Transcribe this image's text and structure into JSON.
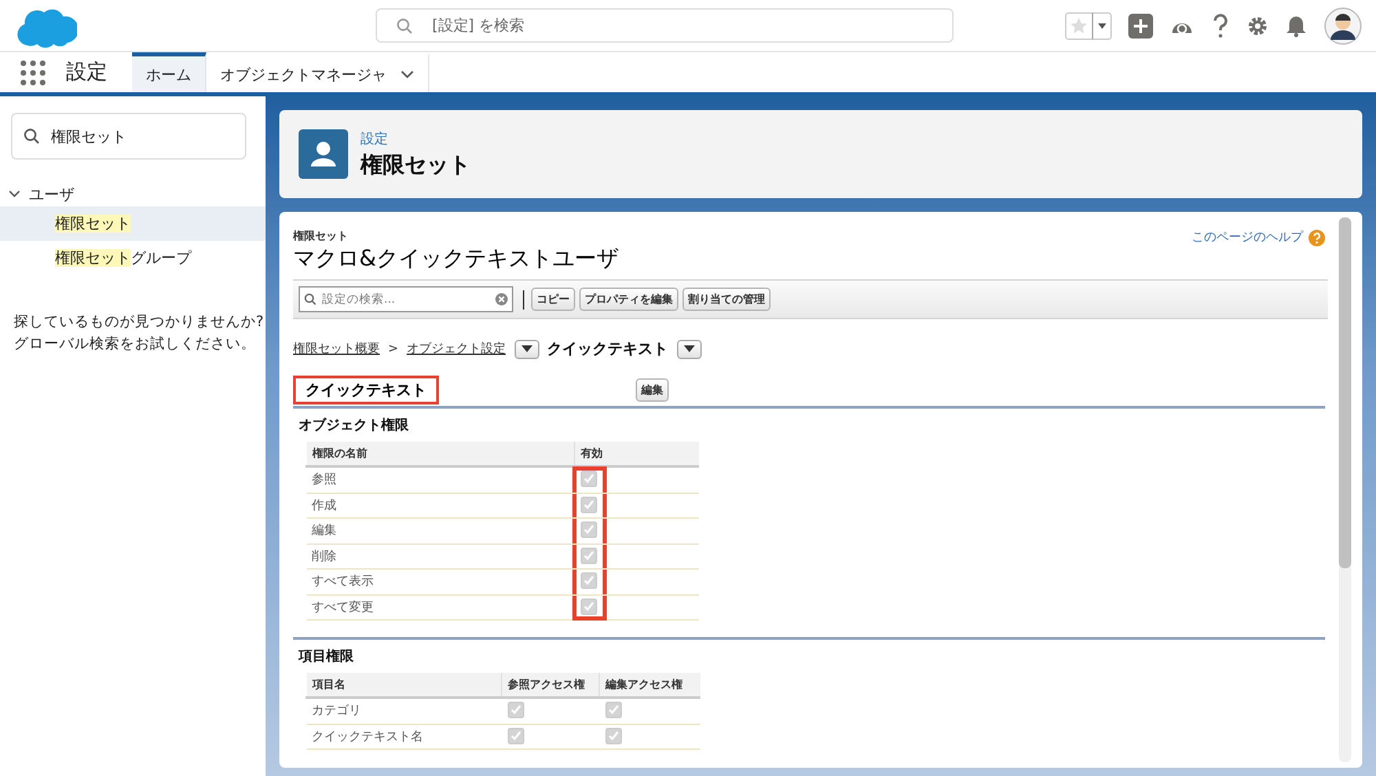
{
  "global_search": {
    "placeholder": "[設定] を検索"
  },
  "nav": {
    "app_name": "設定",
    "tabs": [
      {
        "label": "ホーム",
        "selected": true,
        "has_menu": false
      },
      {
        "label": "オブジェクトマネージャ",
        "selected": false,
        "has_menu": true
      }
    ]
  },
  "sidebar": {
    "search_value": "権限セット",
    "tree": [
      {
        "label": "ユーザ",
        "expanded": true,
        "children": [
          {
            "highlight": "権限セット",
            "selected": true
          },
          {
            "highlight": "権限セット",
            "rest": "グループ",
            "selected": false
          }
        ]
      }
    ],
    "hint_lines": [
      "探しているものが見つかりませんか?",
      "グローバル検索をお試しください。"
    ]
  },
  "page_header": {
    "breadcrumb": "設定",
    "title": "権限セット"
  },
  "detail": {
    "type_label": "権限セット",
    "title": "マクロ&クイックテキストユーザ",
    "help_link": "このページのヘルプ",
    "search": {
      "placeholder": "設定の検索..."
    },
    "toolbar_buttons": [
      "コピー",
      "プロパティを編集",
      "割り当ての管理"
    ],
    "breadcrumbs": [
      {
        "label": "権限セット概要",
        "kind": "link"
      },
      {
        "label": ">",
        "kind": "separator"
      },
      {
        "label": "オブジェクト設定",
        "kind": "menu-link"
      },
      {
        "label": "クイックテキスト",
        "kind": "menu-current"
      }
    ],
    "section": {
      "title": "クイックテキスト",
      "annotated": true,
      "edit_button": "編集"
    },
    "object_permissions": {
      "title": "オブジェクト権限",
      "enabled_column_annotated": true,
      "columns": [
        "権限の名前",
        "有効"
      ],
      "rows": [
        {
          "name": "参照",
          "checked": true
        },
        {
          "name": "作成",
          "checked": true
        },
        {
          "name": "編集",
          "checked": true
        },
        {
          "name": "削除",
          "checked": true
        },
        {
          "name": "すべて表示",
          "checked": true
        },
        {
          "name": "すべて変更",
          "checked": true
        }
      ]
    },
    "field_permissions": {
      "title": "項目権限",
      "columns": [
        "項目名",
        "参照アクセス権",
        "編集アクセス権"
      ],
      "rows": [
        {
          "name": "カテゴリ",
          "read": true,
          "edit": true
        },
        {
          "name": "クイックテキスト名",
          "read": true,
          "edit": true
        }
      ]
    }
  }
}
